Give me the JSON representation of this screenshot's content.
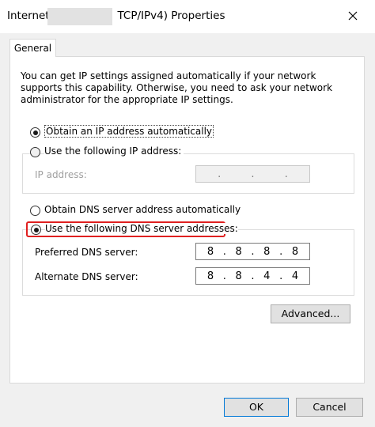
{
  "window": {
    "title_left": "Internet",
    "title_right": "TCP/IPv4) Properties"
  },
  "tabs": [
    {
      "label": "General"
    }
  ],
  "description": "You can get IP settings assigned automatically if your network supports this capability. Otherwise, you need to ask your network administrator for the appropriate IP settings.",
  "ip_section": {
    "auto_label": "Obtain an IP address automatically",
    "manual_label": "Use the following IP address:",
    "ip_address_label": "IP address:",
    "ip_address_value": [
      ".",
      ".",
      "."
    ]
  },
  "dns_section": {
    "auto_label": "Obtain DNS server address automatically",
    "manual_label": "Use the following DNS server addresses:",
    "preferred_label": "Preferred DNS server:",
    "preferred_value": [
      "8",
      ".",
      "8",
      ".",
      "8",
      ".",
      "8"
    ],
    "alternate_label": "Alternate DNS server:",
    "alternate_value": [
      "8",
      ".",
      "8",
      ".",
      "4",
      ".",
      "4"
    ]
  },
  "buttons": {
    "advanced": "Advanced...",
    "ok": "OK",
    "cancel": "Cancel"
  },
  "colors": {
    "highlight": "#e02020",
    "default_button_border": "#0078d7"
  }
}
